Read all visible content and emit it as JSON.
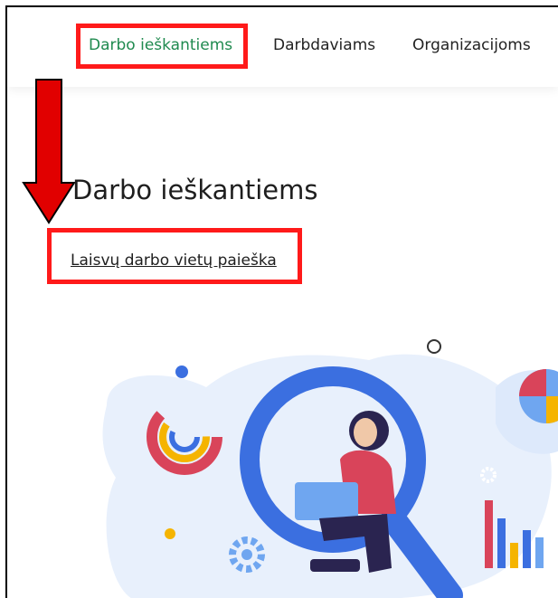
{
  "nav": {
    "items": [
      {
        "label": "Darbo ieškantiems",
        "active": true
      },
      {
        "label": "Darbdaviams",
        "active": false
      },
      {
        "label": "Organizacijoms",
        "active": false
      }
    ]
  },
  "main": {
    "title": "Darbo ieškantiems",
    "search_link": "Laisvų darbo vietų paieška"
  },
  "colors": {
    "active_nav": "#1f8a4f",
    "highlight": "#ff1a1a",
    "arrow": "#e10000",
    "illustration_primary": "#3b6fe0",
    "illustration_bg": "#dde9fb"
  }
}
